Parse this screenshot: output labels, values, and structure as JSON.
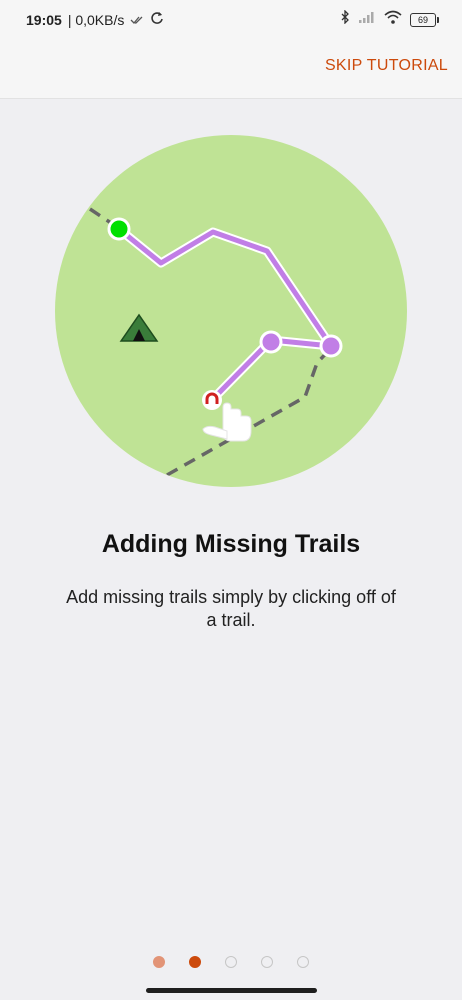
{
  "status": {
    "time": "19:05",
    "network_speed": "| 0,0KB/s",
    "battery": "69"
  },
  "header": {
    "skip_label": "SKIP TUTORIAL"
  },
  "tutorial": {
    "title": "Adding Missing Trails",
    "description": "Add missing trails simply by clicking off of a trail.",
    "current_page": 2,
    "total_pages": 5
  },
  "colors": {
    "accent": "#cc4a0c",
    "map_green": "#bfe395",
    "trail_purple": "#c17ee6",
    "start_green": "#00e000",
    "tent_green": "#3a7d3a",
    "background": "#efeff2"
  },
  "icons": [
    "check-double-icon",
    "sync-icon",
    "bluetooth-icon",
    "signal-icon",
    "wifi-icon",
    "battery-icon",
    "tent-icon",
    "hand-pointer-icon"
  ]
}
